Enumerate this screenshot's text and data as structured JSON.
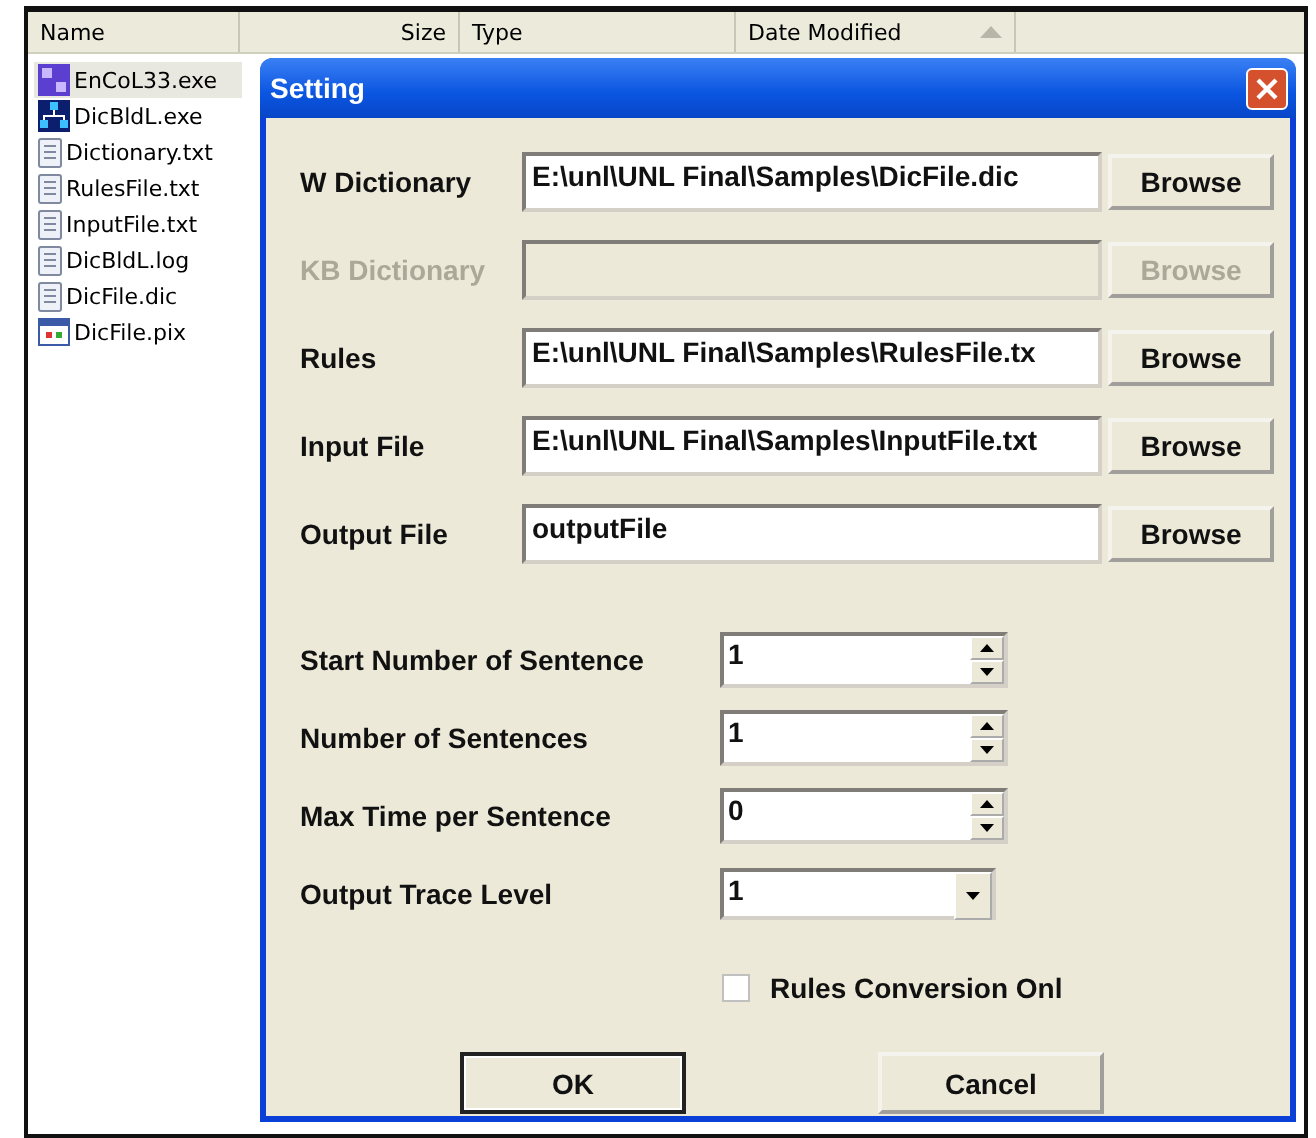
{
  "explorer": {
    "columns": [
      {
        "label": "Name",
        "sorted": false
      },
      {
        "label": "Size",
        "sorted": false
      },
      {
        "label": "Type",
        "sorted": false
      },
      {
        "label": "Date Modified",
        "sorted": true
      }
    ],
    "files": [
      {
        "name": "EnCoL33.exe",
        "kind": "app",
        "selected": true
      },
      {
        "name": "DicBldL.exe",
        "kind": "tool",
        "selected": false
      },
      {
        "name": "Dictionary.txt",
        "kind": "text",
        "selected": false
      },
      {
        "name": "RulesFile.txt",
        "kind": "text",
        "selected": false
      },
      {
        "name": "InputFile.txt",
        "kind": "text",
        "selected": false
      },
      {
        "name": "DicBldL.log",
        "kind": "text",
        "selected": false
      },
      {
        "name": "DicFile.dic",
        "kind": "text",
        "selected": false
      },
      {
        "name": "DicFile.pix",
        "kind": "image",
        "selected": false
      }
    ]
  },
  "dialog": {
    "title": "Setting",
    "files": [
      {
        "label": "W Dictionary",
        "value": "E:\\unl\\UNL Final\\Samples\\DicFile.dic",
        "button": "Browse",
        "disabled": false
      },
      {
        "label": "KB Dictionary",
        "button": "Browse",
        "disabled": true
      },
      {
        "label": "Rules",
        "value": "E:\\unl\\UNL Final\\Samples\\RulesFile.tx",
        "button": "Browse",
        "disabled": false
      },
      {
        "label": "Input File",
        "value": "E:\\unl\\UNL Final\\Samples\\InputFile.txt",
        "button": "Browse",
        "disabled": false
      },
      {
        "label": "Output File",
        "value": "outputFile",
        "button": "Browse",
        "disabled": false
      }
    ],
    "numbers": [
      {
        "label": "Start Number of Sentence",
        "value": "1",
        "kind": "spin"
      },
      {
        "label": "Number of Sentences",
        "value": "1",
        "kind": "spin"
      },
      {
        "label": "Max Time per Sentence",
        "value": "0",
        "kind": "spin"
      },
      {
        "label": "Output Trace Level",
        "value": "1",
        "kind": "combo"
      }
    ],
    "checkbox": {
      "label": "Rules Conversion Onl",
      "checked": false
    },
    "buttons": [
      "OK",
      "Cancel"
    ]
  }
}
